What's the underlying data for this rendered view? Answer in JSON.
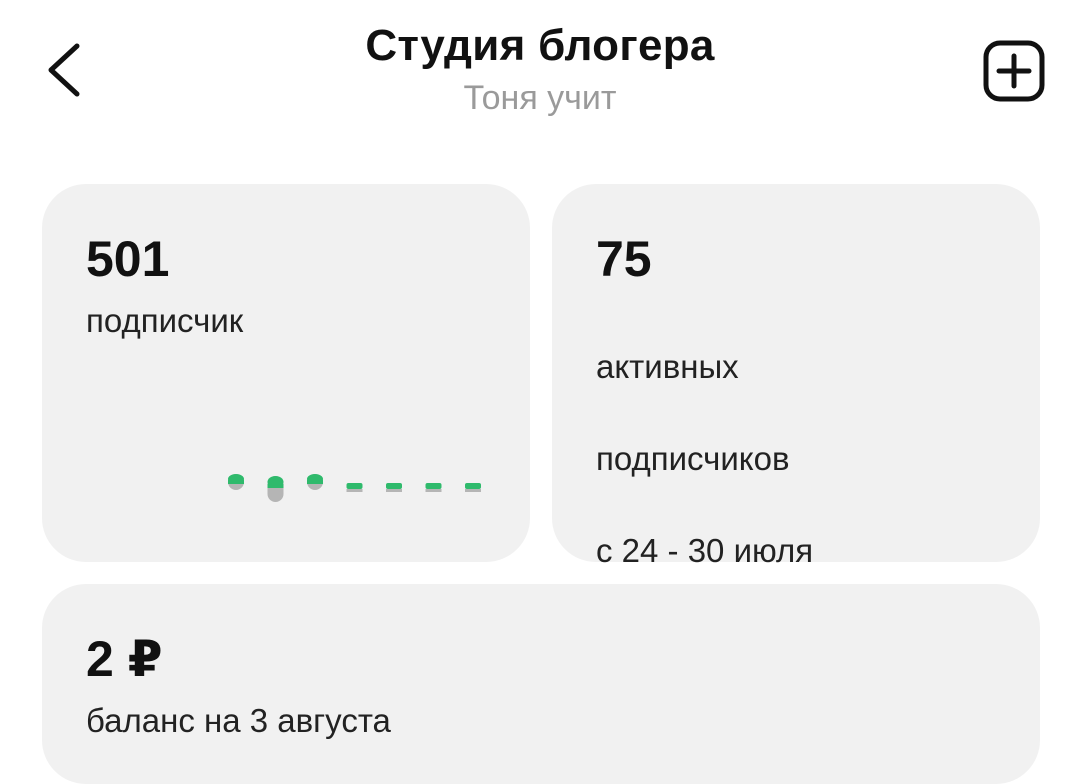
{
  "header": {
    "title": "Студия блогера",
    "subtitle": "Тоня учит",
    "back_icon": "chevron-left-icon",
    "add_icon": "plus-square-icon"
  },
  "subscribers": {
    "value": "501",
    "label": "подписчик"
  },
  "active": {
    "value": "75",
    "label_line1": "активных",
    "label_line2": "подписчиков",
    "label_line3": "с 24 - 30 июля"
  },
  "balance": {
    "value": "2 ₽",
    "label": "баланс на 3 августа"
  },
  "colors": {
    "card_bg": "#f1f1f1",
    "accent_green": "#2fba6c",
    "muted_gray": "#b5b5b5",
    "subtitle_gray": "#9a9a9a"
  },
  "trend": {
    "levels": [
      1,
      2,
      1,
      0,
      0,
      0,
      0
    ]
  }
}
